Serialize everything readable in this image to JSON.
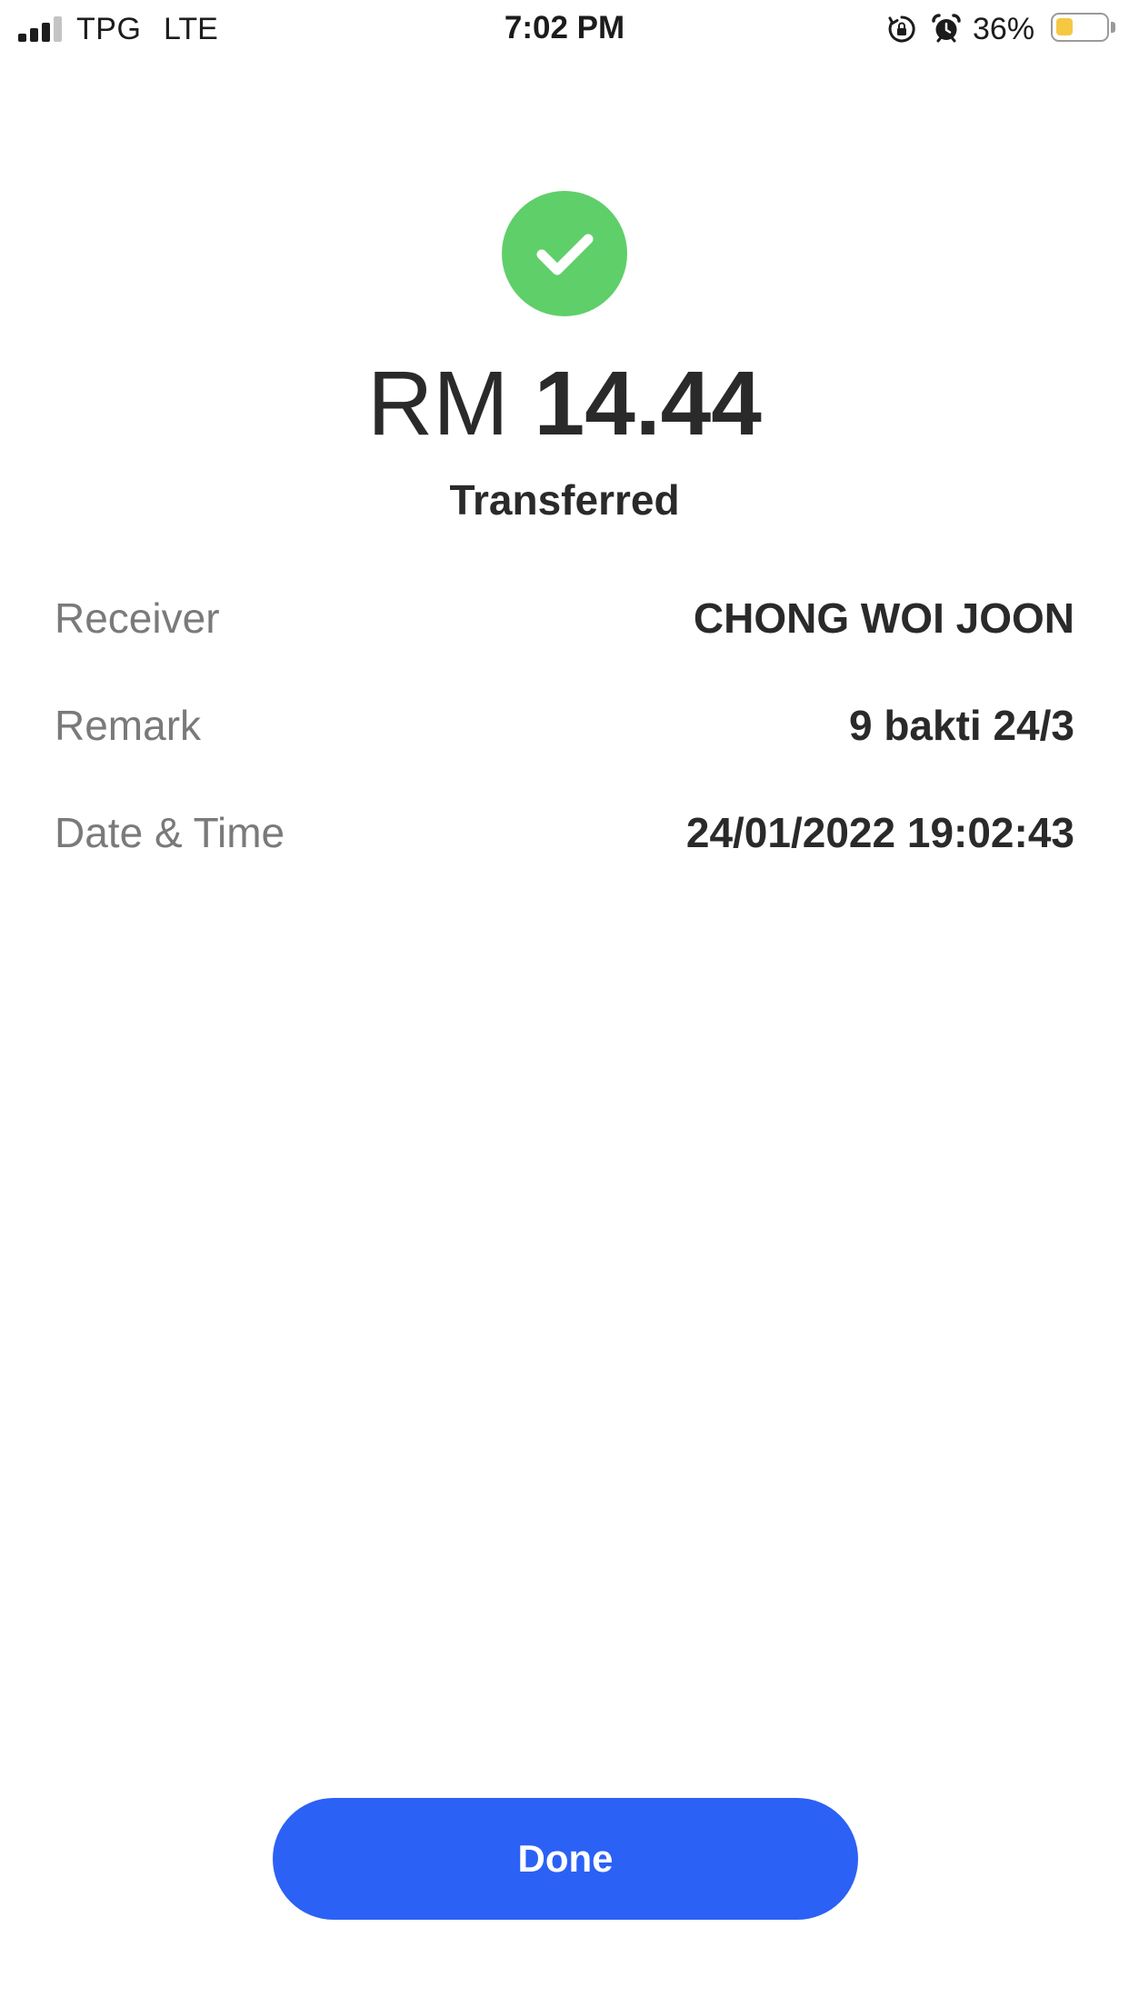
{
  "status_bar": {
    "carrier": "TPG",
    "network": "LTE",
    "time": "7:02 PM",
    "battery_percent_label": "36%",
    "battery_level": 0.36,
    "battery_color": "#f5c842",
    "signal_bars_active": 3,
    "signal_bars_total": 4,
    "icons": [
      "signal-icon",
      "rotation-lock-icon",
      "alarm-icon",
      "battery-icon"
    ]
  },
  "transfer": {
    "status_icon": "checkmark-icon",
    "status_icon_color": "#5fcf6a",
    "currency": "RM",
    "amount": "14.44",
    "status": "Transferred"
  },
  "details": [
    {
      "label": "Receiver",
      "value": "CHONG WOI JOON"
    },
    {
      "label": "Remark",
      "value": "9 bakti 24/3"
    },
    {
      "label": "Date & Time",
      "value": "24/01/2022 19:02:43"
    }
  ],
  "actions": {
    "done_label": "Done",
    "done_color": "#2b61f5"
  }
}
